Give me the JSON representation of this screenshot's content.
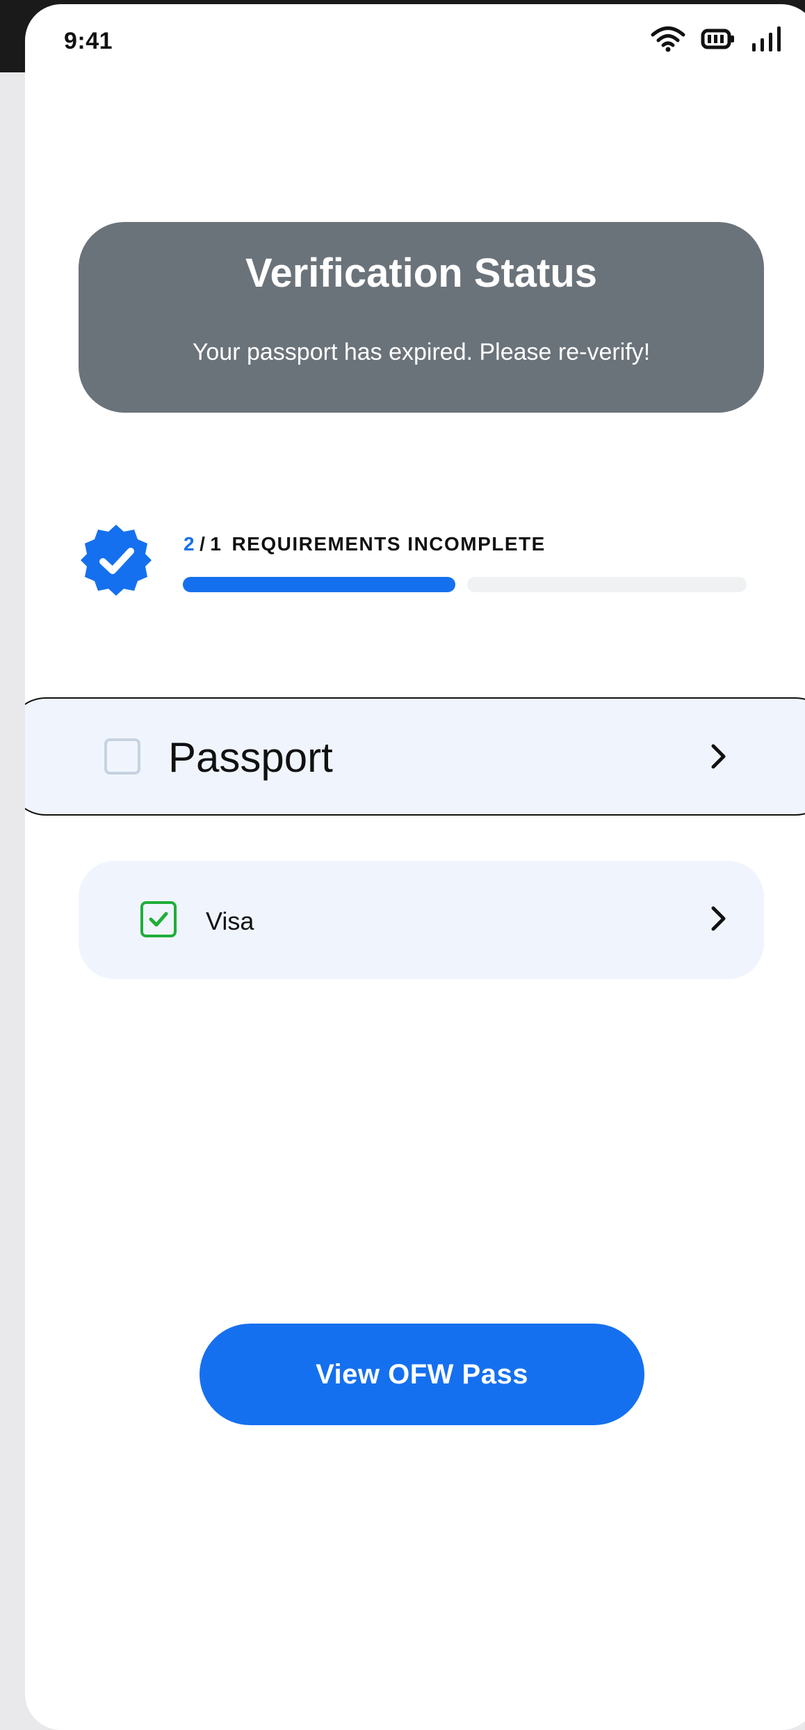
{
  "status_bar": {
    "time": "9:41",
    "icons": [
      "wifi-icon",
      "battery-icon",
      "signal-icon"
    ]
  },
  "banner": {
    "title": "Verification Status",
    "message": "Your passport has expired. Please re-verify!",
    "background": "#6b737a"
  },
  "progress": {
    "completed": "2",
    "separator": "/",
    "total": "1",
    "label": "REQUIREMENTS INCOMPLETE",
    "badge_icon": "verified-badge-icon",
    "accent": "#1570ef",
    "segments": [
      {
        "state": "filled"
      },
      {
        "state": "empty"
      }
    ]
  },
  "requirements": [
    {
      "label": "Passport",
      "checked": false,
      "icon": "chevron-right-icon"
    },
    {
      "label": "Visa",
      "checked": true,
      "icon": "chevron-right-icon",
      "check_color": "#1fae3a"
    }
  ],
  "cta": {
    "label": "View OFW Pass",
    "color": "#1570ef"
  }
}
